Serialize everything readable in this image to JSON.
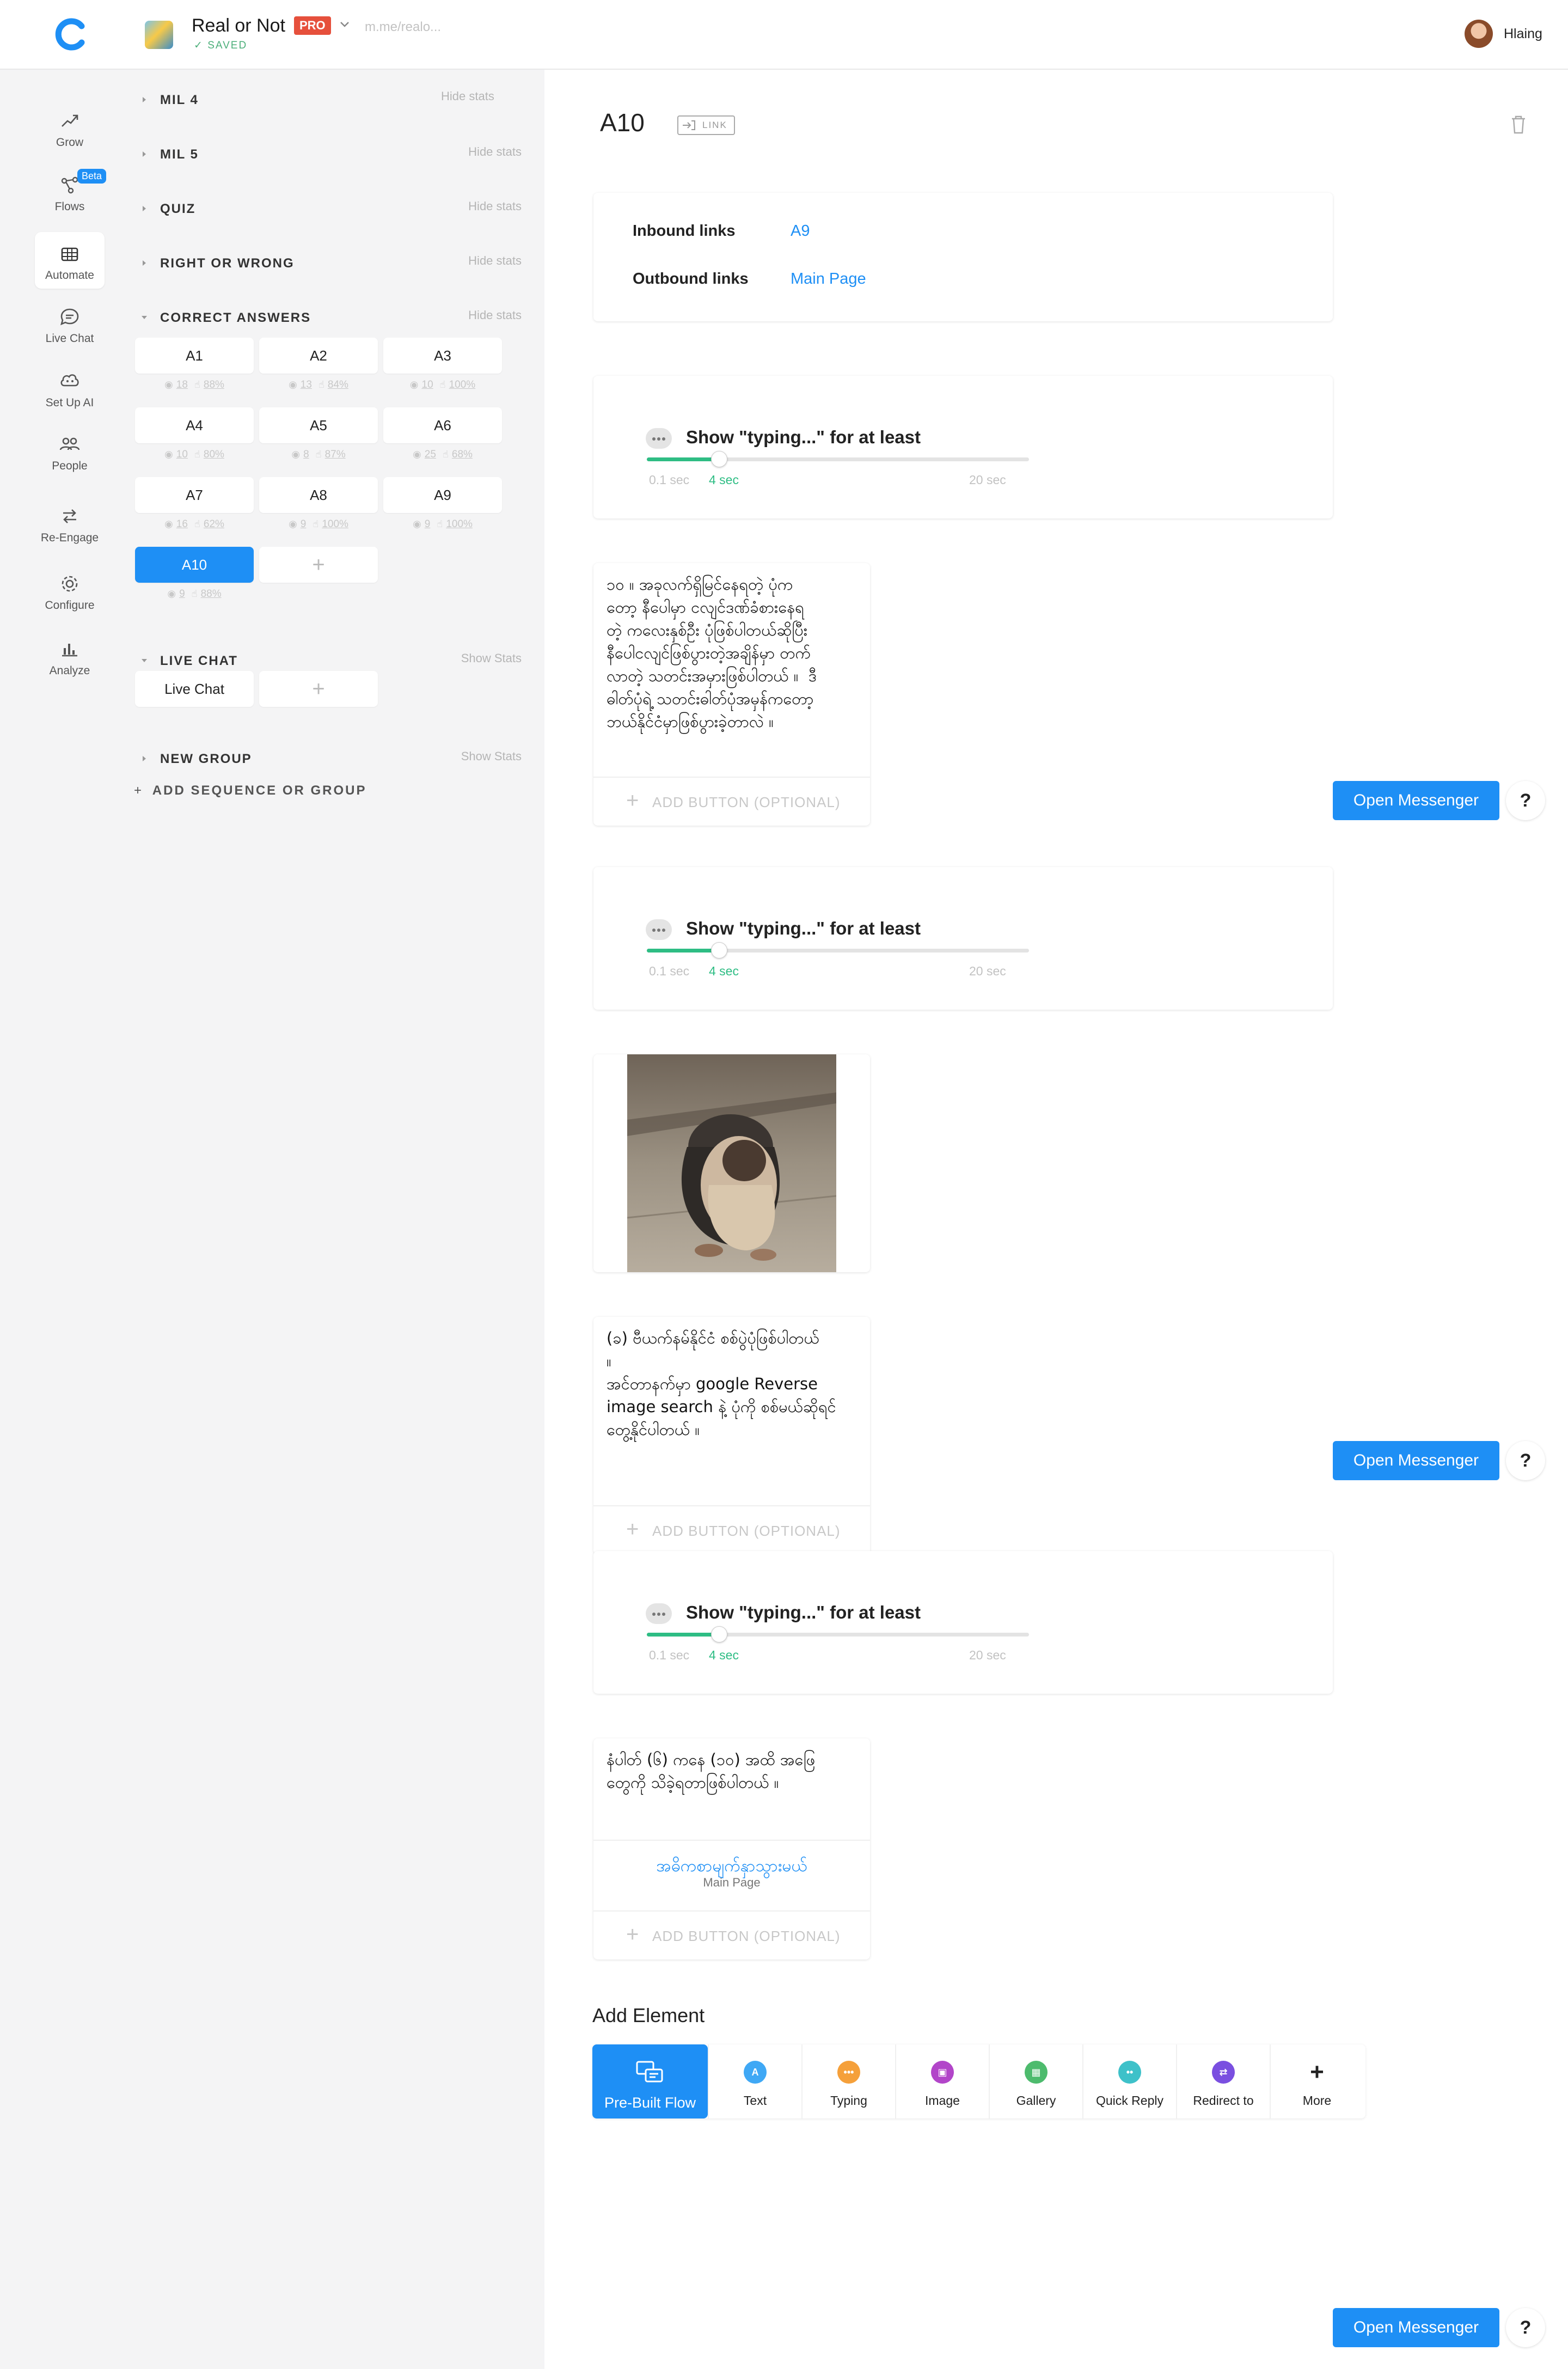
{
  "header": {
    "bot_name": "Real or Not",
    "plan_badge": "PRO",
    "bot_url": "m.me/realo...",
    "save_status": "SAVED",
    "user_name": "Hlaing"
  },
  "nav": {
    "items": [
      {
        "label": "Grow",
        "icon": "grow-icon"
      },
      {
        "label": "Flows",
        "icon": "flows-icon",
        "badge": "Beta"
      },
      {
        "label": "Automate",
        "icon": "automate-icon",
        "active": true
      },
      {
        "label": "Live Chat",
        "icon": "live-chat-icon"
      },
      {
        "label": "Set Up AI",
        "icon": "ai-icon"
      },
      {
        "label": "People",
        "icon": "people-icon"
      },
      {
        "label": "Re-Engage",
        "icon": "re-engage-icon"
      },
      {
        "label": "Configure",
        "icon": "configure-icon"
      },
      {
        "label": "Analyze",
        "icon": "analyze-icon"
      }
    ]
  },
  "sequences": {
    "groups": [
      {
        "title": "MIL 4",
        "stats_toggle": "Hide stats"
      },
      {
        "title": "MIL 5",
        "stats_toggle": "Hide stats"
      },
      {
        "title": "QUIZ",
        "stats_toggle": "Hide stats"
      },
      {
        "title": "RIGHT OR WRONG",
        "stats_toggle": "Hide stats"
      },
      {
        "title": "CORRECT ANSWERS",
        "stats_toggle": "Hide stats"
      },
      {
        "title": "LIVE CHAT",
        "stats_toggle": "Show Stats"
      },
      {
        "title": "NEW GROUP",
        "stats_toggle": "Show Stats"
      }
    ],
    "correct_answers": [
      {
        "label": "A1",
        "views": "18",
        "clicks": "88%"
      },
      {
        "label": "A2",
        "views": "13",
        "clicks": "84%"
      },
      {
        "label": "A3",
        "views": "10",
        "clicks": "100%"
      },
      {
        "label": "A4",
        "views": "10",
        "clicks": "80%"
      },
      {
        "label": "A5",
        "views": "8",
        "clicks": "87%"
      },
      {
        "label": "A6",
        "views": "25",
        "clicks": "68%"
      },
      {
        "label": "A7",
        "views": "16",
        "clicks": "62%"
      },
      {
        "label": "A8",
        "views": "9",
        "clicks": "100%"
      },
      {
        "label": "A9",
        "views": "9",
        "clicks": "100%"
      },
      {
        "label": "A10",
        "views": "9",
        "clicks": "88%",
        "active": true
      }
    ],
    "live_chat_tile": "Live Chat",
    "add_sequence": "ADD SEQUENCE OR GROUP"
  },
  "message": {
    "title": "A10",
    "link_chip": "LINK",
    "inbound_label": "Inbound links",
    "inbound_value": "A9",
    "outbound_label": "Outbound links",
    "outbound_value": "Main Page",
    "typing_label": "Show \"typing...\" for at least",
    "typing_min": "0.1 sec",
    "typing_value": "4 sec",
    "typing_max": "20 sec",
    "typing_fraction": 0.19,
    "text1": "၁၀ ။ အခုလက်ရှိမြင်နေရတဲ့ ပုံက\nတော့ နီပေါမှာ ငလျင်ဒဏ်ခံစားနေရ\nတဲ့ ကလေးနှစ်ဦး ပုံဖြစ်ပါတယ်ဆိုပြီး\nနီပေါငလျင်ဖြစ်ပွားတဲ့အချိန်မှာ တက်\nလာတဲ့ သတင်းအမှားဖြစ်ပါတယ် ။  ဒီ\nဓါတ်ပုံရဲ့ သတင်းဓါတ်ပုံအမှန်ကတော့\nဘယ်နိုင်ငံမှာဖြစ်ပွားခဲ့တာလဲ ။",
    "text2": "(ခ) ဗီယက်နမ်နိုင်ငံ စစ်ပွဲပုံဖြစ်ပါတယ်\n။\nအင်တာနက်မှာ google Reverse\nimage search နဲ့ ပုံကို စစ်မယ်ဆိုရင်\nတွေ့နိုင်ပါတယ် ။",
    "text3": "နံပါတ် (၆) ကနေ (၁၀) အထိ အဖြေ\nတွေကို သိခဲ့ရတာဖြစ်ပါတယ် ။",
    "quick_button_title": "အဓိကစာမျက်နှာသွားမယ်",
    "quick_button_target": "Main Page",
    "add_button": "ADD BUTTON (OPTIONAL)",
    "open_messenger": "Open Messenger",
    "help": "?"
  },
  "add_element": {
    "title": "Add Element",
    "prebuilt": "Pre-Built Flow",
    "tools": [
      {
        "label": "Text",
        "icon": "text-icon",
        "color": "#3fa8f5"
      },
      {
        "label": "Typing",
        "icon": "typing-icon",
        "color": "#f5a03a"
      },
      {
        "label": "Image",
        "icon": "image-icon",
        "color": "#b245c9"
      },
      {
        "label": "Gallery",
        "icon": "gallery-icon",
        "color": "#4dbb6d"
      },
      {
        "label": "Quick Reply",
        "icon": "quick-reply-icon",
        "color": "#3ec1c9"
      },
      {
        "label": "Redirect to",
        "icon": "redirect-icon",
        "color": "#7a4fe0"
      },
      {
        "label": "More",
        "icon": "plus-icon",
        "color": "#222222"
      }
    ]
  }
}
